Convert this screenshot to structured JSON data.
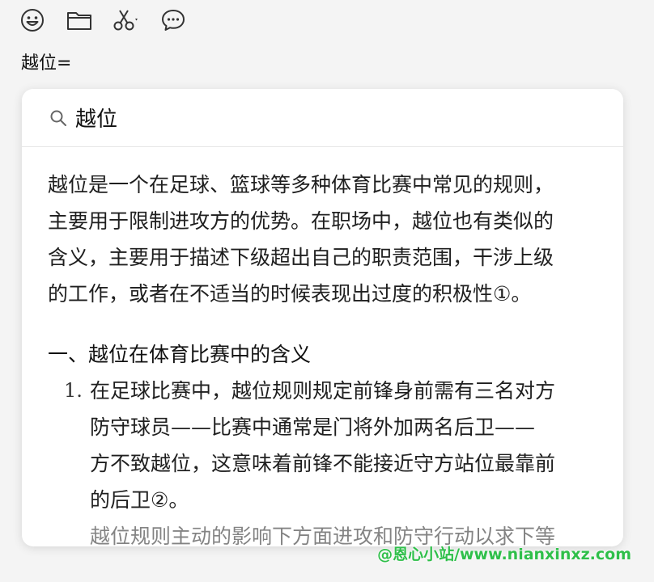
{
  "toolbar": {
    "icons": [
      "emoji-icon",
      "folder-icon",
      "scissors-icon",
      "chat-icon"
    ]
  },
  "input": {
    "text": "越位="
  },
  "card": {
    "query": "越位",
    "intro_lines": [
      "越位是一个在足球、篮球等多种体育比赛中常见的规则，",
      "主要用于限制进攻方的优势。在职场中，越位也有类似的",
      "含义，主要用于描述下级超出自己的职责范围，干涉上级",
      "的工作，或者在不适当的时候表现出过度的积极性①。"
    ],
    "section1_heading": "一、越位在体育比赛中的含义",
    "list": [
      {
        "num": "1.",
        "lines": [
          "在足球比赛中，越位规则规定前锋身前需有三名对方",
          "防守球员——比赛中通常是门将外加两名后卫——",
          "方不致越位，这意味着前锋不能接近守方站位最靠前",
          "的后卫②。"
        ]
      }
    ],
    "cut_line": "越位规则主动的影响下方面进攻和防守行动以求下等"
  },
  "watermark": "@恩心小站/www.nianxinxz.com",
  "colors": {
    "watermark": "#2fbf4a",
    "card_bg": "#ffffff",
    "page_bg": "#f4f4f4"
  }
}
